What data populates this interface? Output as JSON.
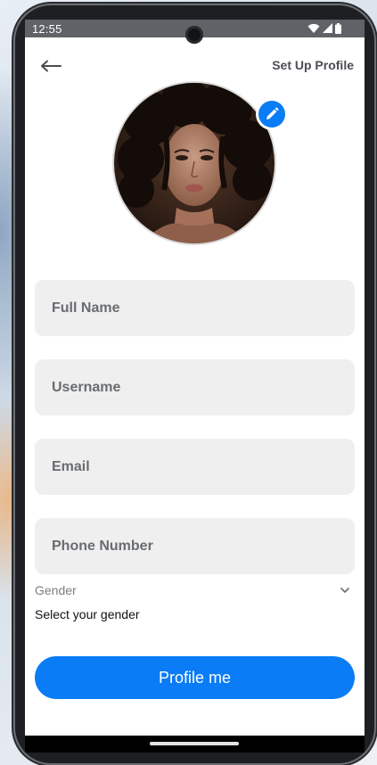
{
  "status_bar": {
    "time": "12:55",
    "icons": [
      "wifi-icon",
      "signal-icon",
      "battery-icon"
    ]
  },
  "header": {
    "back_icon": "arrow-left-icon",
    "title": "Set Up Profile"
  },
  "avatar": {
    "edit_icon": "pencil-icon"
  },
  "form": {
    "full_name_placeholder": "Full Name",
    "username_placeholder": "Username",
    "email_placeholder": "Email",
    "phone_placeholder": "Phone Number",
    "gender_label": "Gender",
    "gender_value": "Select your gender",
    "gender_icon": "chevron-down-icon"
  },
  "submit": {
    "label": "Profile me"
  },
  "colors": {
    "accent": "#0a7cf5",
    "field_bg": "#efefef",
    "status_bar_bg": "#5f6368"
  }
}
